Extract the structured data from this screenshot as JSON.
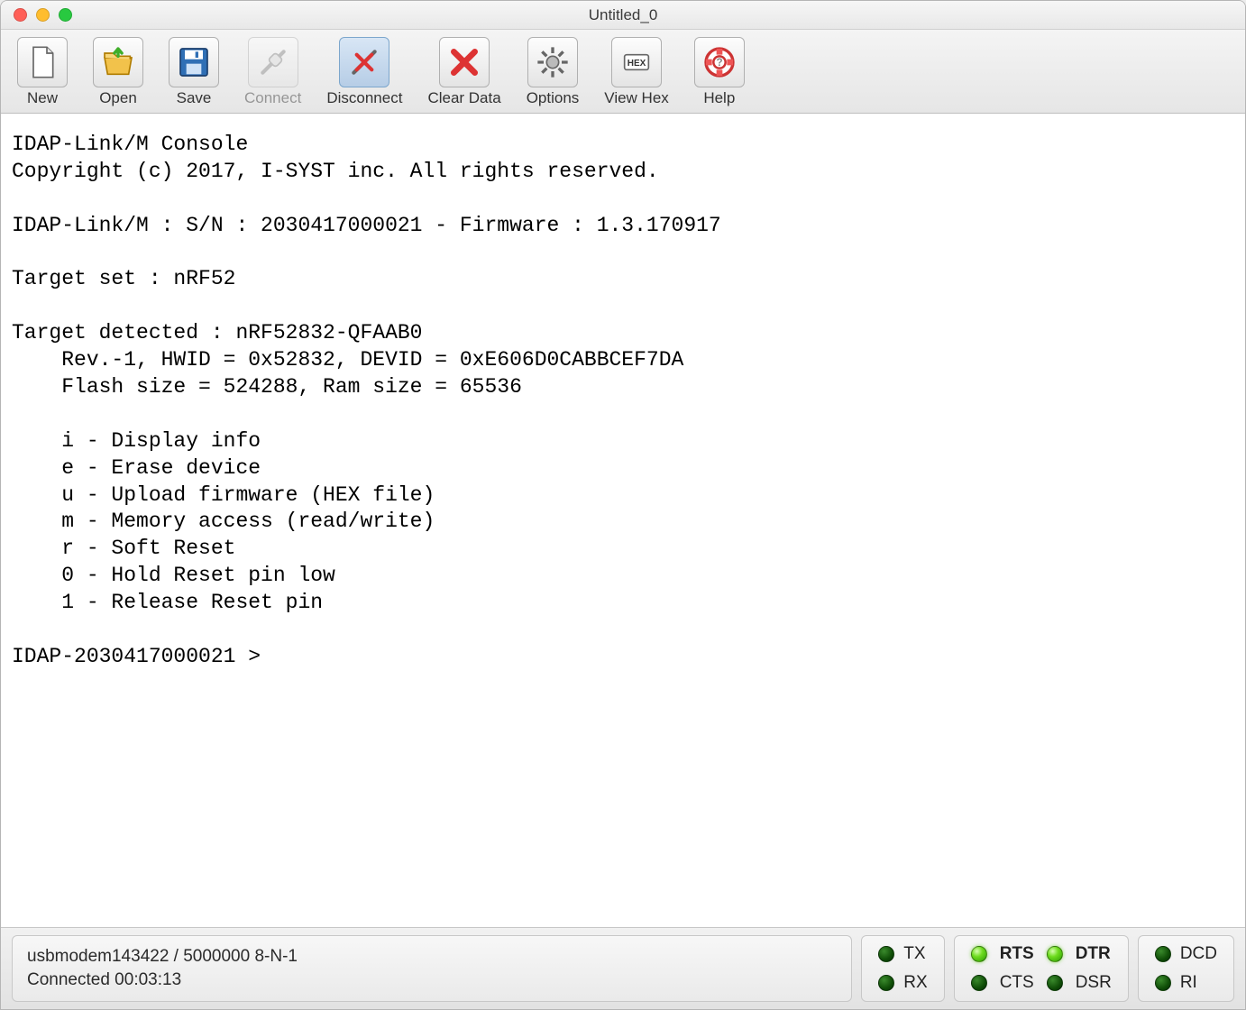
{
  "window": {
    "title": "Untitled_0"
  },
  "toolbar": {
    "items": [
      {
        "id": "new",
        "label": "New",
        "interactable": true
      },
      {
        "id": "open",
        "label": "Open",
        "interactable": true
      },
      {
        "id": "save",
        "label": "Save",
        "interactable": true
      },
      {
        "id": "connect",
        "label": "Connect",
        "interactable": false
      },
      {
        "id": "disconnect",
        "label": "Disconnect",
        "interactable": true
      },
      {
        "id": "clear-data",
        "label": "Clear Data",
        "interactable": true
      },
      {
        "id": "options",
        "label": "Options",
        "interactable": true
      },
      {
        "id": "view-hex",
        "label": "View Hex",
        "interactable": true
      },
      {
        "id": "help",
        "label": "Help",
        "interactable": true
      }
    ]
  },
  "console": {
    "lines": [
      "IDAP-Link/M Console",
      "Copyright (c) 2017, I-SYST inc. All rights reserved.",
      "",
      "IDAP-Link/M : S/N : 2030417000021 - Firmware : 1.3.170917",
      "",
      "Target set : nRF52",
      "",
      "Target detected : nRF52832-QFAAB0",
      "    Rev.-1, HWID = 0x52832, DEVID = 0xE606D0CABBCEF7DA",
      "    Flash size = 524288, Ram size = 65536",
      "",
      "    i - Display info",
      "    e - Erase device",
      "    u - Upload firmware (HEX file)",
      "    m - Memory access (read/write)",
      "    r - Soft Reset",
      "    0 - Hold Reset pin low",
      "    1 - Release Reset pin",
      "",
      "IDAP-2030417000021 >"
    ]
  },
  "status": {
    "port_line": "usbmodem143422 / 5000000 8-N-1",
    "conn_line": "Connected 00:03:13",
    "leds": {
      "tx": {
        "label": "TX",
        "on": false,
        "bold": false
      },
      "rx": {
        "label": "RX",
        "on": false,
        "bold": false
      },
      "rts": {
        "label": "RTS",
        "on": true,
        "bold": true
      },
      "cts": {
        "label": "CTS",
        "on": false,
        "bold": false
      },
      "dtr": {
        "label": "DTR",
        "on": true,
        "bold": true
      },
      "dsr": {
        "label": "DSR",
        "on": false,
        "bold": false
      },
      "dcd": {
        "label": "DCD",
        "on": false,
        "bold": false
      },
      "ri": {
        "label": "RI",
        "on": false,
        "bold": false
      }
    }
  }
}
